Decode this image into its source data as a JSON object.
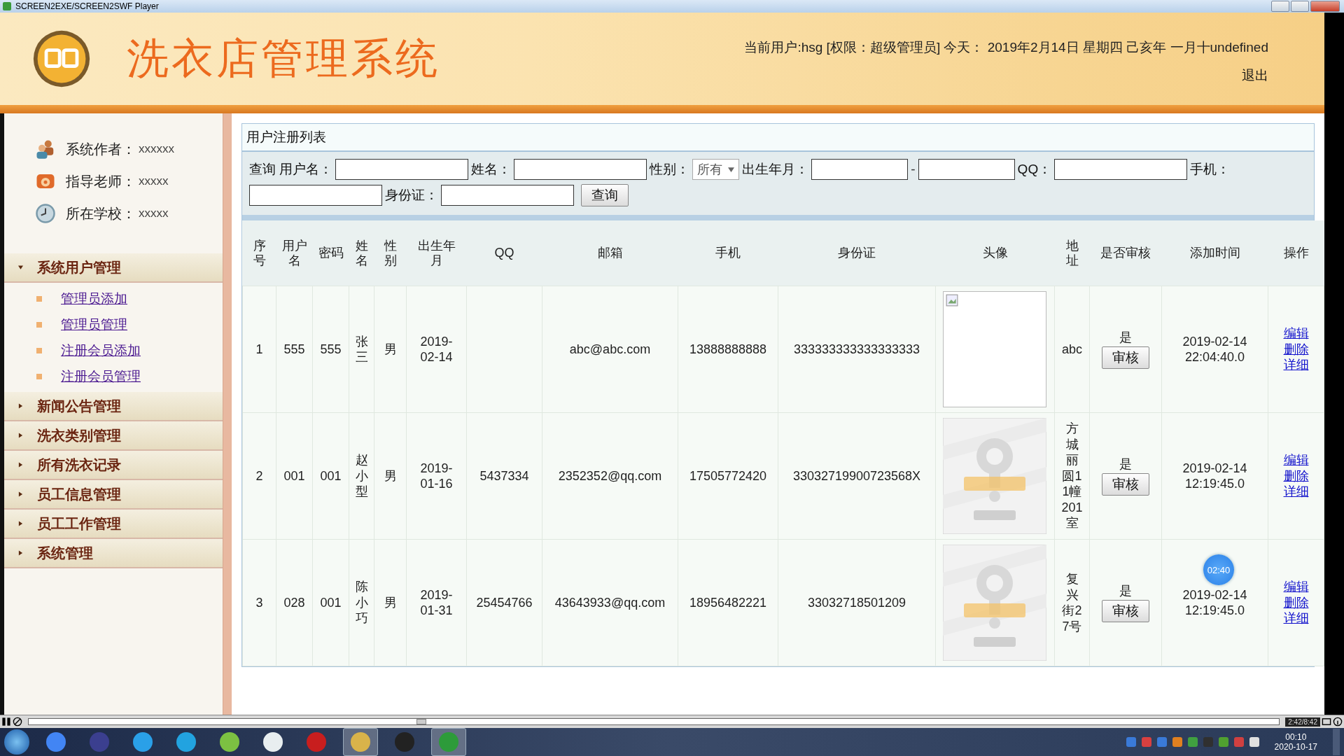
{
  "window": {
    "title": "SCREEN2EXE/SCREEN2SWF Player"
  },
  "header": {
    "title": "洗衣店管理系统",
    "user_info": "当前用户:hsg [权限：超级管理员] 今天： 2019年2月14日 星期四 己亥年 一月十undefined",
    "logout": "退出"
  },
  "sidebar": {
    "info": [
      {
        "kind": "people",
        "label": "系统作者：",
        "value": "xxxxxx"
      },
      {
        "kind": "phone",
        "label": "指导老师：",
        "value": "xxxxx"
      },
      {
        "kind": "clock",
        "label": "所在学校：",
        "value": "xxxxx"
      }
    ],
    "menu": [
      {
        "label": "系统用户管理",
        "expanded": true,
        "children": [
          {
            "label": "管理员添加"
          },
          {
            "label": "管理员管理"
          },
          {
            "label": "注册会员添加"
          },
          {
            "label": "注册会员管理"
          }
        ]
      },
      {
        "label": "新闻公告管理",
        "expanded": false
      },
      {
        "label": "洗衣类别管理",
        "expanded": false
      },
      {
        "label": "所有洗衣记录",
        "expanded": false
      },
      {
        "label": "员工信息管理",
        "expanded": false
      },
      {
        "label": "员工工作管理",
        "expanded": false
      },
      {
        "label": "系统管理",
        "expanded": false
      }
    ]
  },
  "panel": {
    "title": "用户注册列表",
    "search": [
      {
        "kind": "text",
        "label": "查询 用户名："
      },
      {
        "kind": "text",
        "label": "姓名："
      },
      {
        "kind": "select",
        "label": "性别：",
        "value": "所有"
      },
      {
        "kind": "range",
        "label": "出生年月：",
        "separator": "-"
      },
      {
        "kind": "text",
        "label": "QQ："
      },
      {
        "kind": "text",
        "label": "手机："
      },
      {
        "kind": "text",
        "label": "身份证："
      }
    ],
    "search_button": "查询",
    "table": {
      "columns": [
        "序号",
        "用户名",
        "密码",
        "姓名",
        "性别",
        "出生年月",
        "QQ",
        "邮箱",
        "手机",
        "身份证",
        "头像",
        "地址",
        "是否审核",
        "添加时间",
        "操作"
      ],
      "rows": [
        {
          "no": "1",
          "username": "555",
          "password": "555",
          "name": "张三",
          "gender": "男",
          "birth": "2019-02-14",
          "qq": "",
          "email": "abc@abc.com",
          "phone": "13888888888",
          "id_card": "333333333333333333",
          "avatar": {
            "kind": "broken"
          },
          "address": "abc",
          "audited": "是",
          "audit_button": "审核",
          "added": "2019-02-14 22:04:40.0",
          "actions": [
            "编辑",
            "删除",
            "详细"
          ]
        },
        {
          "no": "2",
          "username": "001",
          "password": "001",
          "name": "赵小型",
          "gender": "男",
          "birth": "2019-01-16",
          "qq": "5437334",
          "email": "2352352@qq.com",
          "phone": "17505772420",
          "id_card": "33032719900723568X",
          "avatar": {
            "kind": "placeholder"
          },
          "address": "方城丽圆11幢201室",
          "audited": "是",
          "audit_button": "审核",
          "added": "2019-02-14 12:19:45.0",
          "actions": [
            "编辑",
            "删除",
            "详细"
          ]
        },
        {
          "no": "3",
          "username": "028",
          "password": "001",
          "name": "陈小巧",
          "gender": "男",
          "birth": "2019-01-31",
          "qq": "25454766",
          "email": "43643933@qq.com",
          "phone": "18956482221",
          "id_card": "33032718501209",
          "avatar": {
            "kind": "placeholder"
          },
          "address": "复兴街27号",
          "audited": "是",
          "audit_button": "审核",
          "added": "2019-02-14 12:19:45.0",
          "actions": [
            "编辑",
            "删除",
            "详细"
          ]
        }
      ]
    }
  },
  "timer": "02:40",
  "player": {
    "position": "2:42/8:42",
    "level": 0.31
  },
  "taskbar": {
    "time": "00:10",
    "date": "2020-10-17"
  }
}
